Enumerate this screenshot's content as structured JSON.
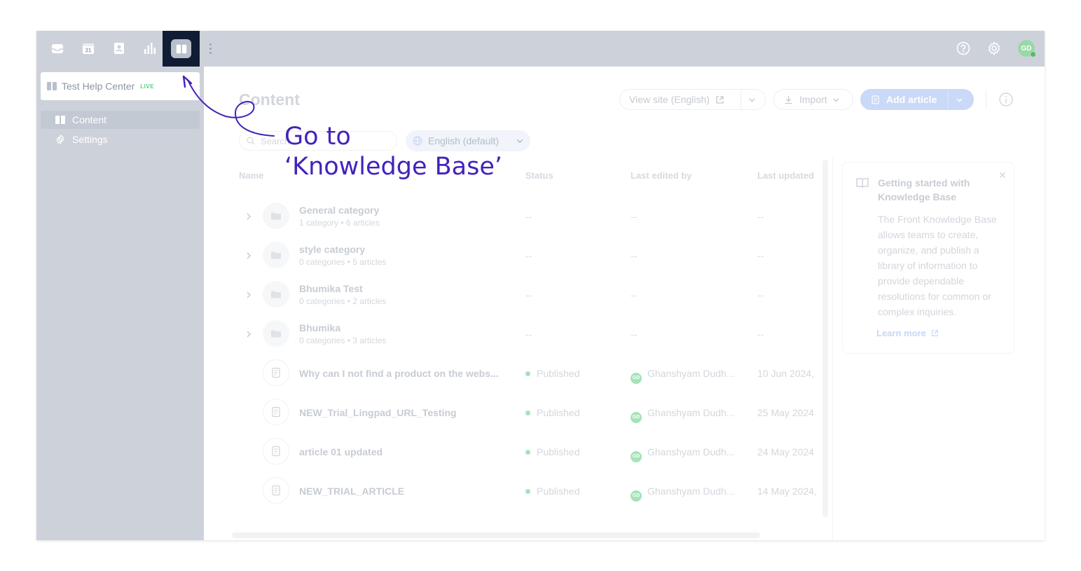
{
  "colors": {
    "accent": "#4422bb",
    "topbar": "#cdd2da",
    "active_nav": "#0f1c33",
    "published": "#a6e3b8"
  },
  "topbar": {
    "nav_icons": [
      "inbox-icon",
      "calendar-icon",
      "contacts-icon",
      "analytics-icon",
      "knowledge-base-icon"
    ],
    "calendar_day": "31",
    "avatar_initials": "GD"
  },
  "sidebar": {
    "help_center": {
      "title": "Test Help Center",
      "badge": "LIVE"
    },
    "items": [
      {
        "label": "Content",
        "icon": "book-icon"
      },
      {
        "label": "Settings",
        "icon": "gear-icon"
      }
    ]
  },
  "main": {
    "title": "Content",
    "view_site_label": "View site (English)",
    "import_label": "Import",
    "add_article_label": "Add article",
    "search_placeholder": "Search",
    "language_label": "English (default)",
    "columns": {
      "name": "Name",
      "status": "Status",
      "last_edited_by": "Last edited by",
      "last_updated": "Last updated"
    },
    "categories": [
      {
        "name": "General category",
        "meta": "1 category • 6 articles",
        "status": "--",
        "editor": "--",
        "updated": "--"
      },
      {
        "name": "style category",
        "meta": "0 categories • 5 articles",
        "status": "--",
        "editor": "--",
        "updated": "--"
      },
      {
        "name": "Bhumika Test",
        "meta": "0 categories • 2 articles",
        "status": "--",
        "editor": "--",
        "updated": "--"
      },
      {
        "name": "Bhumika",
        "meta": "0 categories • 3 articles",
        "status": "--",
        "editor": "--",
        "updated": "--"
      }
    ],
    "articles": [
      {
        "name": "Why can I not find a product on the webs...",
        "status": "Published",
        "editor": "Ghanshyam Dudh...",
        "editor_initials": "GD",
        "updated": "10 Jun 2024,"
      },
      {
        "name": "NEW_Trial_Lingpad_URL_Testing",
        "status": "Published",
        "editor": "Ghanshyam Dudh...",
        "editor_initials": "GD",
        "updated": "25 May 2024"
      },
      {
        "name": "article 01 updated",
        "status": "Published",
        "editor": "Ghanshyam Dudh...",
        "editor_initials": "GD",
        "updated": "24 May 2024"
      },
      {
        "name": "NEW_TRIAL_ARTICLE",
        "status": "Published",
        "editor": "Ghanshyam Dudh...",
        "editor_initials": "GD",
        "updated": "14 May 2024,"
      }
    ]
  },
  "getting_started": {
    "title": "Getting started with Knowledge Base",
    "body": "The Front Knowledge Base allows teams to create, organize, and publish a library of information to provide dependable resolutions for common or complex inquiries.",
    "link": "Learn more"
  },
  "annotation": {
    "line1": "Go to",
    "line2": "‘Knowledge Base’"
  }
}
